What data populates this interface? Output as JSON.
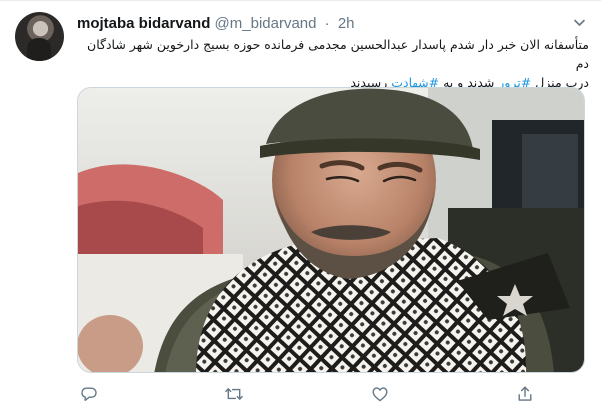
{
  "author": {
    "display_name": "mojtaba bidarvand",
    "handle": "@m_bidarvand",
    "separator": "·",
    "timestamp": "2h"
  },
  "tweet": {
    "line1": "متأسفانه الان خبر دار شدم پاسدار عبدالحسین مجدمی فرمانده حوزه بسیج دارخوین شهر شادگان دم",
    "line2_before": "درب منزل ",
    "hashtag1": "#ترور",
    "line2_middle": " شدند و به ",
    "hashtag2": "#شهادت",
    "line2_after": " رسیدند"
  },
  "media": {
    "icon": "photo"
  },
  "actions": {
    "icons": [
      "reply-icon",
      "retweet-icon",
      "like-icon",
      "share-icon"
    ]
  },
  "colors": {
    "text": "#14171a",
    "secondary": "#657786",
    "hashtag": "#1b95e0",
    "border": "#e6ecf0"
  }
}
